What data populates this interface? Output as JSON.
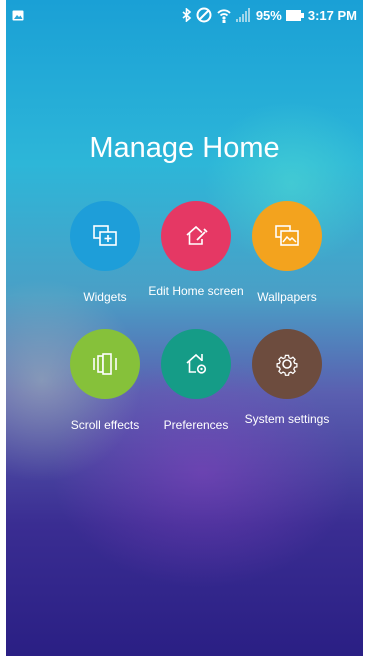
{
  "status_bar": {
    "battery_percent": "95%",
    "time": "3:17 PM",
    "icons": [
      "image-icon",
      "bluetooth-icon",
      "do-not-disturb-icon",
      "wifi-icon",
      "signal-icon",
      "battery-icon"
    ]
  },
  "title": "Manage Home",
  "items": [
    {
      "label": "Widgets",
      "icon": "widgets-icon",
      "color": "#1e9ed9"
    },
    {
      "label": "Edit Home screen",
      "icon": "edit-home-icon",
      "color": "#e53864"
    },
    {
      "label": "Wallpapers",
      "icon": "wallpapers-icon",
      "color": "#f3a31e"
    },
    {
      "label": "Scroll effects",
      "icon": "scroll-effects-icon",
      "color": "#86c13a"
    },
    {
      "label": "Preferences",
      "icon": "preferences-icon",
      "color": "#159c87"
    },
    {
      "label": "System settings",
      "icon": "gear-icon",
      "color": "#6d4c3e"
    }
  ]
}
